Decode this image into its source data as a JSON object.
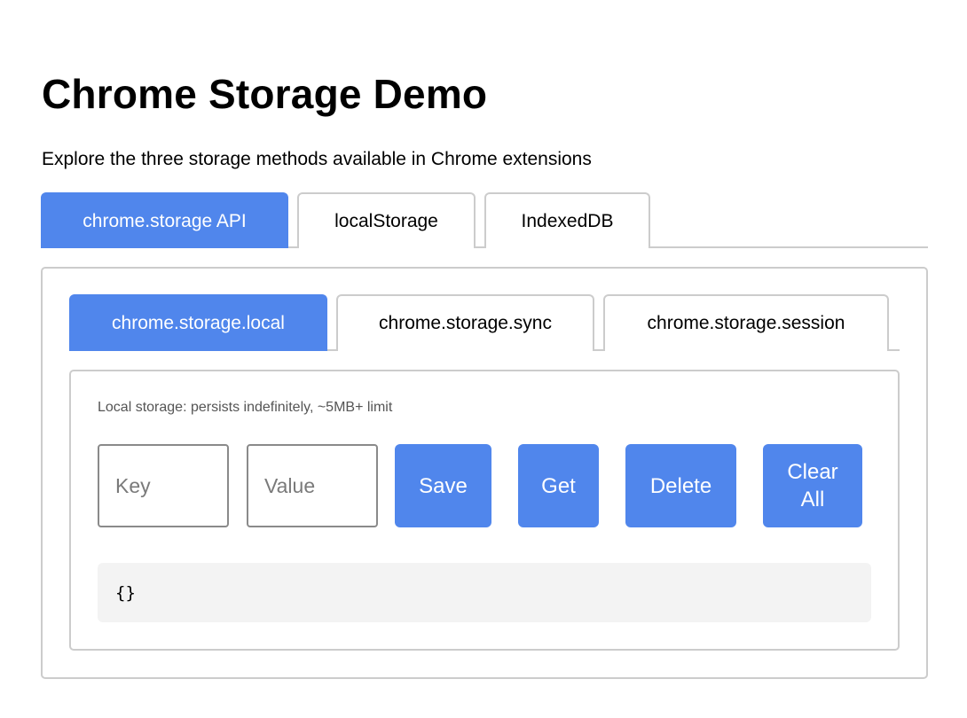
{
  "header": {
    "title": "Chrome Storage Demo",
    "subtitle": "Explore the three storage methods available in Chrome extensions"
  },
  "outer_tabs": [
    {
      "label": "chrome.storage API",
      "active": true
    },
    {
      "label": "localStorage",
      "active": false
    },
    {
      "label": "IndexedDB",
      "active": false
    }
  ],
  "inner_tabs": [
    {
      "label": "chrome.storage.local",
      "active": true
    },
    {
      "label": "chrome.storage.sync",
      "active": false
    },
    {
      "label": "chrome.storage.session",
      "active": false
    }
  ],
  "panel": {
    "description": "Local storage: persists indefinitely, ~5MB+ limit",
    "key_input": {
      "value": "",
      "placeholder": "Key"
    },
    "value_input": {
      "value": "",
      "placeholder": "Value"
    },
    "buttons": {
      "save": "Save",
      "get": "Get",
      "delete": "Delete",
      "clear_all": "Clear All"
    },
    "output": "{}"
  },
  "colors": {
    "accent": "#5086ec",
    "border": "#cccccc",
    "output_bg": "#f3f3f3"
  }
}
